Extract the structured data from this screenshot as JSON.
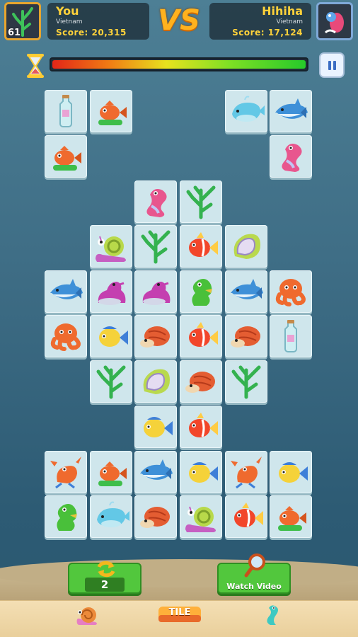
{
  "player": {
    "name": "You",
    "country": "Vietnam",
    "score": "Score: 20,315",
    "level": "61"
  },
  "vs_label": "VS",
  "opponent": {
    "name": "Hihiha",
    "country": "Vietnam",
    "score": "Score: 17,124"
  },
  "timer": {
    "remaining_fraction": 1.0
  },
  "powerups": {
    "shuffle_count": "2",
    "watch_video_label": "Watch Video"
  },
  "bottom_nav": {
    "logo_text": "TILE"
  },
  "tiles": [
    [
      "bottle",
      "goldfish",
      null,
      null,
      "whale",
      "shark"
    ],
    [
      "goldfish",
      null,
      null,
      null,
      null,
      "seahorse-pink"
    ],
    [
      null,
      null,
      "seahorse-pink",
      "seaweed",
      null,
      null
    ],
    [
      null,
      "snail",
      "seaweed",
      "clownfish",
      "seashell",
      null
    ],
    [
      "shark",
      "seal",
      "seal",
      "seadragon",
      "shark",
      "octopus"
    ],
    [
      "octopus",
      "yellowfish",
      "hermit",
      "clownfish",
      "hermit",
      "bottle"
    ],
    [
      null,
      "seaweed",
      "seashell",
      "hermit",
      "seaweed",
      null
    ],
    [
      null,
      null,
      "yellowfish",
      "clownfish",
      null,
      null
    ],
    [
      "lobster",
      "goldfish",
      "shark",
      "yellowfish",
      "lobster",
      "yellowfish"
    ],
    [
      "seadragon",
      "whale",
      "hermit",
      "snail",
      "clownfish",
      "goldfish"
    ]
  ],
  "colors": {
    "accent": "#ffd23a",
    "vs": "#ffb21e",
    "tile": "#cfe6ec",
    "button": "#52c73d"
  }
}
